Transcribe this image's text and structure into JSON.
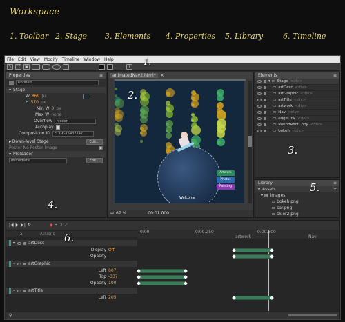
{
  "header": {
    "title": "Workspace"
  },
  "legend": [
    {
      "label": "1. Toolbar"
    },
    {
      "label": "2. Stage"
    },
    {
      "label": "3. Elements"
    },
    {
      "label": "4. Properties"
    },
    {
      "label": "5. Library"
    },
    {
      "label": "6. Timeline"
    }
  ],
  "callouts": {
    "c1": "1.",
    "c2": "2.",
    "c3": "3.",
    "c4": "4.",
    "c5": "5.",
    "c6": "6."
  },
  "menu": [
    "File",
    "Edit",
    "View",
    "Modify",
    "Timeline",
    "Window",
    "Help"
  ],
  "properties": {
    "tab": "Properties",
    "name": "Untitled",
    "stage_section": "Stage",
    "w_label": "W",
    "w_value": "869",
    "w_unit": "px",
    "h_label": "H",
    "h_value": "570",
    "h_unit": "px",
    "min_w_label": "Min W",
    "min_w_value": "0",
    "min_w_unit": "px",
    "max_w_label": "Max W",
    "max_w_value": "none",
    "overflow_label": "Overflow",
    "overflow_value": "hidden",
    "autoplay_label": "Autoplay",
    "composition_label": "Composition ID",
    "composition_value": "EDGE-15437747",
    "downlevel_label": "Down-level Stage",
    "downlevel_btn": "Edit...",
    "poster_label": "Poster",
    "poster_value": "No Poster Image",
    "preloader_label": "Preloader",
    "preloader_value": "Immediate",
    "preloader_btn": "Edit..."
  },
  "stage": {
    "tab": "animatedNav2.html*",
    "zoom": "67 %",
    "time": "00:01.000",
    "nav_items": [
      {
        "label": "Artwork",
        "color": "#2a8a5a"
      },
      {
        "label": "Photos",
        "color": "#2a6ab0"
      },
      {
        "label": "Painting",
        "color": "#8a3ab0"
      }
    ],
    "welcome": "Welcome"
  },
  "elements": {
    "tab": "Elements",
    "items": [
      {
        "name": "Stage",
        "tag": "<div>"
      },
      {
        "name": "artDesc",
        "tag": "<div>"
      },
      {
        "name": "artGraphic",
        "tag": "<div>"
      },
      {
        "name": "artTitle",
        "tag": "<div>"
      },
      {
        "name": "artwork",
        "tag": "<div>"
      },
      {
        "name": "Nav",
        "tag": "<div>"
      },
      {
        "name": "edgeLink",
        "tag": "<div>"
      },
      {
        "name": "RoundRectCopy",
        "tag": "<div>"
      },
      {
        "name": "bokeh",
        "tag": "<div>"
      }
    ]
  },
  "library": {
    "tab": "Library",
    "assets_label": "Assets",
    "folder": "images",
    "files": [
      "bokeh.png",
      "car.png",
      "skier2.png"
    ]
  },
  "timeline": {
    "actions_label": "Actions",
    "ruler": [
      "0:00",
      "0:00.250",
      "0:00.500"
    ],
    "ruler_labels": [
      "artwork",
      "Nav"
    ],
    "rows": [
      {
        "name": "artDesc",
        "props": [
          {
            "label": "Display",
            "value": "Off"
          },
          {
            "label": "Opacity",
            "value": ""
          }
        ]
      },
      {
        "name": "artGraphic",
        "props": [
          {
            "label": "Left",
            "value": "607"
          },
          {
            "label": "Top",
            "value": "-337"
          },
          {
            "label": "Opacity",
            "value": "100"
          }
        ]
      },
      {
        "name": "artTitle",
        "props": [
          {
            "label": "Left",
            "value": "205"
          }
        ]
      }
    ]
  },
  "colors": {
    "accent_callout": "#e8d66a",
    "track": "#3d7a5a",
    "app_bg": "#2b2b2b"
  }
}
